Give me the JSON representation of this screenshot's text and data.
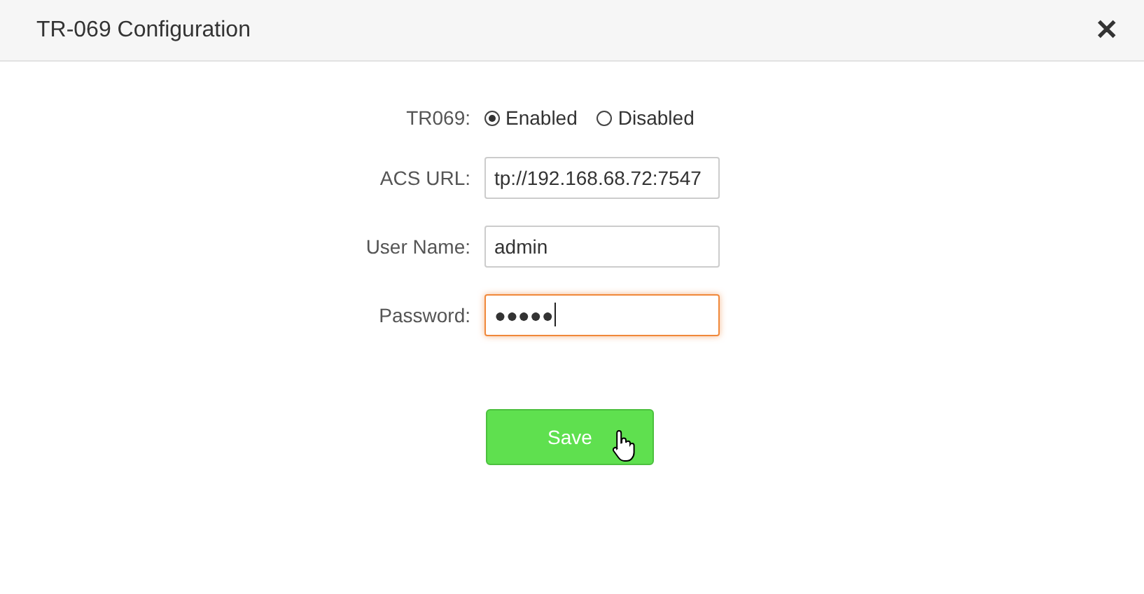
{
  "window": {
    "title": "TR-069 Configuration",
    "close": "✕"
  },
  "form": {
    "tr069": {
      "label": "TR069:",
      "options": [
        {
          "label": "Enabled",
          "selected": true
        },
        {
          "label": "Disabled",
          "selected": false
        }
      ]
    },
    "fields": [
      {
        "label": "ACS URL:",
        "value": "tp://192.168.68.72:7547",
        "focused": false
      },
      {
        "label": "User Name:",
        "value": "admin",
        "focused": false
      },
      {
        "label": "Password:",
        "value": "●●●●●",
        "focused": true
      }
    ]
  },
  "buttons": [
    {
      "label": "Save"
    }
  ]
}
